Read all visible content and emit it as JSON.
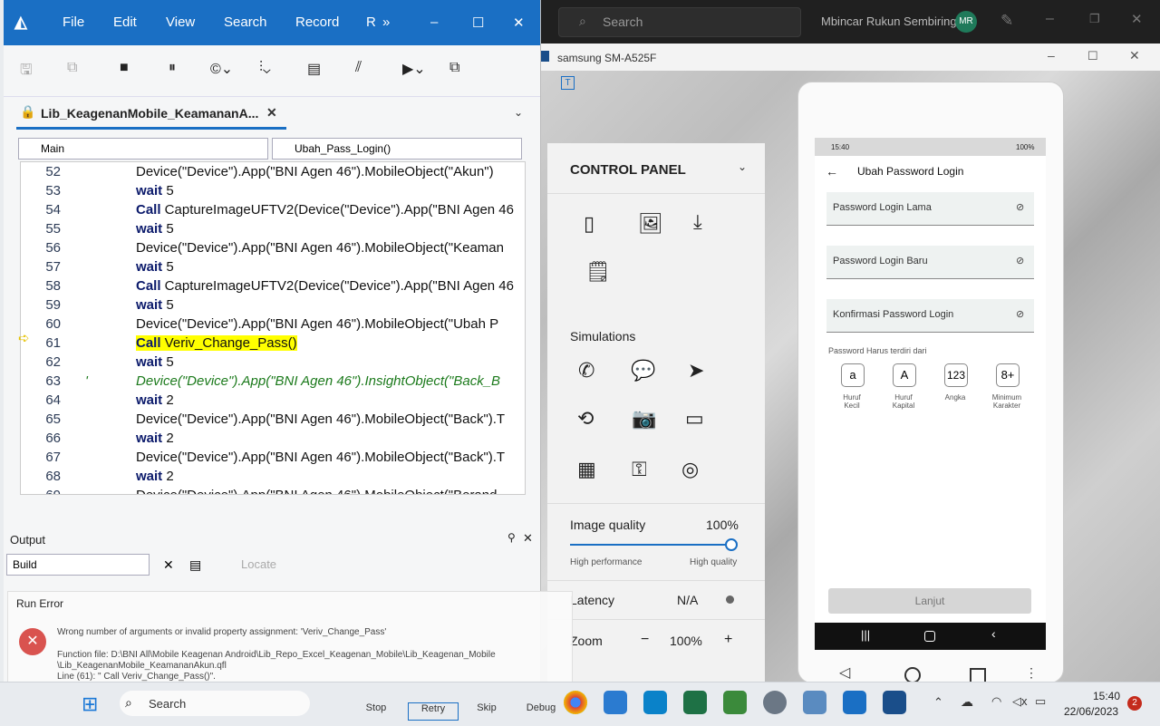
{
  "desktop": {
    "search_placeholder": "Search",
    "user_name": "Mbincar Rukun Sembiring",
    "user_initials": "MR",
    "mirror_window_title": "samsung SM-A525F"
  },
  "uft": {
    "menu": [
      "File",
      "Edit",
      "View",
      "Search",
      "Record",
      "R"
    ],
    "document_tab": "Lib_KeagenanMobile_KeamananA...",
    "combo_left": "Main",
    "combo_right": "Ubah_Pass_Login()",
    "lines": [
      {
        "n": "52",
        "pre": "",
        "kw": "",
        "text": "Device(\"Device\").App(\"BNI Agen 46\").MobileObject(\"Akun\")"
      },
      {
        "n": "53",
        "pre": "",
        "kw": "wait",
        "text": " 5"
      },
      {
        "n": "54",
        "pre": "",
        "kw": "Call",
        "text": " CaptureImageUFTV2(Device(\"Device\").App(\"BNI Agen 46"
      },
      {
        "n": "55",
        "pre": "",
        "kw": "wait",
        "text": " 5"
      },
      {
        "n": "56",
        "pre": "",
        "kw": "",
        "text": "Device(\"Device\").App(\"BNI Agen 46\").MobileObject(\"Keaman"
      },
      {
        "n": "57",
        "pre": "",
        "kw": "wait",
        "text": " 5"
      },
      {
        "n": "58",
        "pre": "",
        "kw": "Call",
        "text": " CaptureImageUFTV2(Device(\"Device\").App(\"BNI Agen 46"
      },
      {
        "n": "59",
        "pre": "",
        "kw": "wait",
        "text": " 5"
      },
      {
        "n": "60",
        "pre": "",
        "kw": "",
        "text": "Device(\"Device\").App(\"BNI Agen 46\").MobileObject(\"Ubah P"
      },
      {
        "n": "61",
        "pre": "",
        "kw": "Call",
        "text": " Veriv_Change_Pass()"
      },
      {
        "n": "62",
        "pre": "",
        "kw": "wait",
        "text": " 5"
      },
      {
        "n": "63",
        "pre": "'",
        "kw": "",
        "text": "Device(\"Device\").App(\"BNI Agen 46\").InsightObject(\"Back_B"
      },
      {
        "n": "64",
        "pre": "",
        "kw": "wait",
        "text": " 2"
      },
      {
        "n": "65",
        "pre": "",
        "kw": "",
        "text": "Device(\"Device\").App(\"BNI Agen 46\").MobileObject(\"Back\").T"
      },
      {
        "n": "66",
        "pre": "",
        "kw": "wait",
        "text": " 2"
      },
      {
        "n": "67",
        "pre": "",
        "kw": "",
        "text": "Device(\"Device\").App(\"BNI Agen 46\").MobileObject(\"Back\").T"
      },
      {
        "n": "68",
        "pre": "",
        "kw": "wait",
        "text": " 2"
      },
      {
        "n": "69",
        "pre": "",
        "kw": "",
        "text": "Device(\"Device\").App(\"BNI Agen 46\").MobileObject(\"Berand"
      }
    ],
    "output_title": "Output",
    "output_combo": "Build",
    "locate_label": "Locate"
  },
  "error": {
    "title": "Run Error",
    "message": "Wrong number of arguments or invalid property assignment: 'Veriv_Change_Pass'",
    "file_line1": "Function file: D:\\BNI All\\Mobile Keagenan Android\\Lib_Repo_Excel_Keagenan_Mobile\\Lib_Keagenan_Mobile",
    "file_line2": "\\Lib_KeagenanMobile_KeamananAkun.qfl",
    "line_info": "Line (61): \"                    Call Veriv_Change_Pass()\".",
    "buttons": [
      "Stop",
      "Retry",
      "Skip",
      "Debug"
    ]
  },
  "control_panel": {
    "title": "CONTROL PANEL",
    "simulations": "Simulations",
    "image_quality_label": "Image quality",
    "image_quality_value": "100%",
    "image_quality_level": 1.0,
    "high_performance": "High performance",
    "high_quality": "High quality",
    "latency_label": "Latency",
    "latency_value": "N/A",
    "zoom_label": "Zoom",
    "zoom_value": "100%",
    "zoom_minus": "−",
    "zoom_plus": "+"
  },
  "phone": {
    "status_time": "15:40",
    "status_battery": "100%",
    "screen_title": "Ubah Password Login",
    "field1": "Password Login Lama",
    "field2": "Password Login Baru",
    "field3": "Konfirmasi Password Login",
    "rules_title": "Password Harus terdiri dari",
    "rules": [
      {
        "symbol": "a",
        "label1": "Huruf",
        "label2": "Kecil"
      },
      {
        "symbol": "A",
        "label1": "Huruf",
        "label2": "Kapital"
      },
      {
        "symbol": "123",
        "label1": "Angka",
        "label2": ""
      },
      {
        "symbol": "8+",
        "label1": "Minimum",
        "label2": "Karakter"
      }
    ],
    "next_button": "Lanjut"
  },
  "taskbar": {
    "search_label": "Search",
    "time": "15:40",
    "date": "22/06/2023",
    "notif_count": "2"
  }
}
